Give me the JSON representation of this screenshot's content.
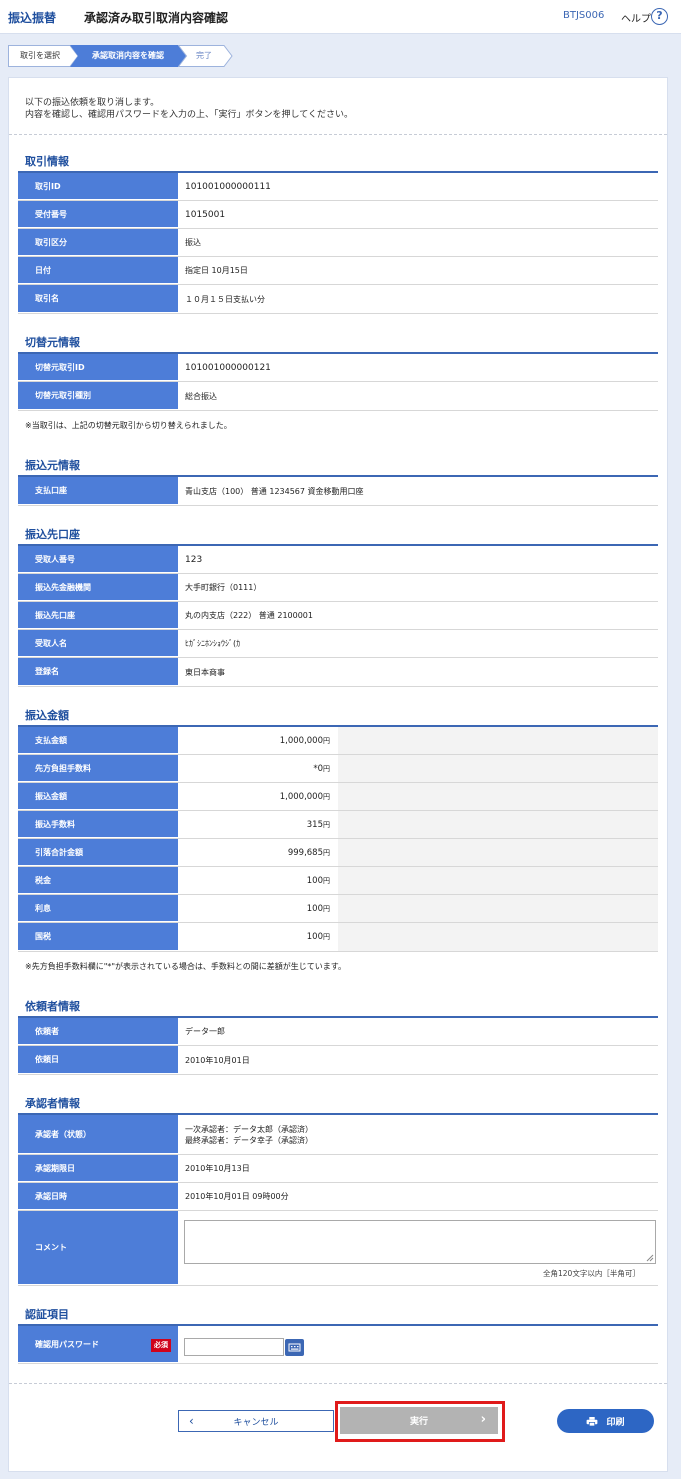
{
  "header": {
    "brand": "振込振替",
    "title": "承認済み取引取消内容確認",
    "screen_code": "BTJS006",
    "help_label": "ヘルプ",
    "help_icon": "?"
  },
  "steps": [
    "取引を選択",
    "承認取消内容を確認",
    "完了"
  ],
  "intro": [
    "以下の振込依頼を取り消します。",
    "内容を確認し、確認用パスワードを入力の上、「実行」ボタンを押してください。"
  ],
  "sections": {
    "torihiki": {
      "title": "取引情報",
      "rows": [
        {
          "label": "取引ID",
          "value": "101001000000111"
        },
        {
          "label": "受付番号",
          "value": "1015001"
        },
        {
          "label": "取引区分",
          "value": "振込"
        },
        {
          "label": "日付",
          "value": "指定日 10月15日"
        },
        {
          "label": "取引名",
          "value": "１０月１５日支払い分"
        }
      ]
    },
    "kirikae": {
      "title": "切替元情報",
      "rows": [
        {
          "label": "切替元取引ID",
          "value": "101001000000121"
        },
        {
          "label": "切替元取引種別",
          "value": "総合振込"
        }
      ],
      "note": "※当取引は、上記の切替元取引から切り替えられました。"
    },
    "furikomimoto": {
      "title": "振込元情報",
      "rows": [
        {
          "label": "支払口座",
          "value": "青山支店（100） 普通 1234567 資金移動用口座"
        }
      ]
    },
    "furikomisaki": {
      "title": "振込先口座",
      "rows": [
        {
          "label": "受取人番号",
          "value": "123"
        },
        {
          "label": "振込先金融機関",
          "value": "大手町銀行（0111）"
        },
        {
          "label": "振込先口座",
          "value": "丸の内支店（222） 普通 2100001"
        },
        {
          "label": "受取人名",
          "value": "ﾋｶﾞｼﾆﾎﾝｼｮｳｼﾞ(ｶ"
        },
        {
          "label": "登録名",
          "value": "東日本商事"
        }
      ]
    },
    "kingaku": {
      "title": "振込金額",
      "rows": [
        {
          "label": "支払金額",
          "value": "1,000,000",
          "unit": "円"
        },
        {
          "label": "先方負担手数料",
          "value": "*0",
          "unit": "円"
        },
        {
          "label": "振込金額",
          "value": "1,000,000",
          "unit": "円"
        },
        {
          "label": "振込手数料",
          "value": "315",
          "unit": "円"
        },
        {
          "label": "引落合計金額",
          "value": "999,685",
          "unit": "円"
        },
        {
          "label": "税金",
          "value": "100",
          "unit": "円"
        },
        {
          "label": "利息",
          "value": "100",
          "unit": "円"
        },
        {
          "label": "国税",
          "value": "100",
          "unit": "円"
        }
      ],
      "note": "※先方負担手数料欄に\"*\"が表示されている場合は、手数料との間に差額が生じています。"
    },
    "irai": {
      "title": "依頼者情報",
      "rows": [
        {
          "label": "依頼者",
          "value": "データ一郎"
        },
        {
          "label": "依頼日",
          "value": "2010年10月01日"
        }
      ]
    },
    "shonin": {
      "title": "承認者情報",
      "rows": [
        {
          "label": "承認者（状態）",
          "value": "一次承認者：データ太郎（承認済）",
          "value2": "最終承認者：データ幸子（承認済）"
        },
        {
          "label": "承認期限日",
          "value": "2010年10月13日"
        },
        {
          "label": "承認日時",
          "value": "2010年10月01日 09時00分"
        },
        {
          "label": "コメント",
          "value": ""
        }
      ],
      "comment_limit": "全角120文字以内［半角可］"
    },
    "ninsho": {
      "title": "認証項目",
      "rows": [
        {
          "label": "確認用パスワード",
          "required": "必須"
        }
      ]
    }
  },
  "buttons": {
    "cancel": "キャンセル",
    "execute": "実行",
    "print": "印刷"
  },
  "colors": {
    "accent": "#3c67b4",
    "header_cell": "#4d7dd8",
    "required": "#d0021b",
    "highlight_frame": "#e01a1a"
  }
}
